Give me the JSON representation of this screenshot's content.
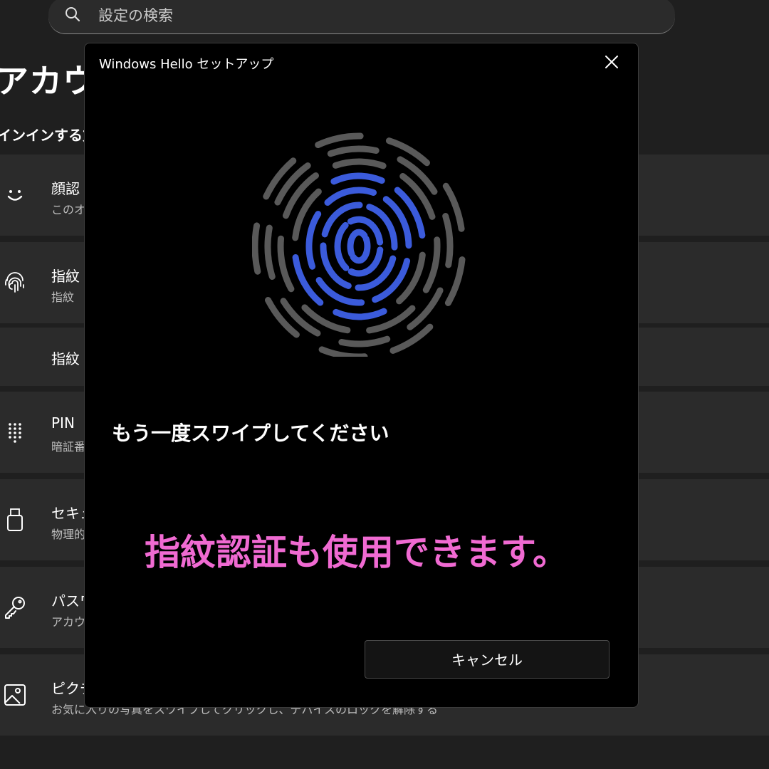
{
  "settings": {
    "search_placeholder": "設定の検索",
    "page_title": "アカウン",
    "section_title": "インインする方",
    "items": [
      {
        "title": "顔認",
        "subtitle": "このオ",
        "icon": "smile-icon"
      },
      {
        "title": "指紋",
        "subtitle": "指紋",
        "icon": "fingerprint-icon"
      },
      {
        "title": "指紋",
        "subtitle": ""
      },
      {
        "title": "PIN",
        "subtitle": "暗証番",
        "icon": "keypad-icon"
      },
      {
        "title": "セキュ",
        "subtitle": "物理的",
        "icon": "usb-key-icon"
      },
      {
        "title": "パスワ",
        "subtitle": "アカウ",
        "icon": "key-icon"
      },
      {
        "title": "ピクチ",
        "subtitle": "お気に入りの写真をスワイプしてクリックし、デバイスのロックを解除する",
        "icon": "picture-icon"
      }
    ]
  },
  "dialog": {
    "title": "Windows Hello セットアップ",
    "instruction": "もう一度スワイプしてください",
    "cancel_label": "キャンセル",
    "fingerprint_accent": "#3b5bdb",
    "fingerprint_base": "#595959"
  },
  "overlay": {
    "caption": "指紋認証も使用できます。",
    "color": "#f06ad2"
  }
}
